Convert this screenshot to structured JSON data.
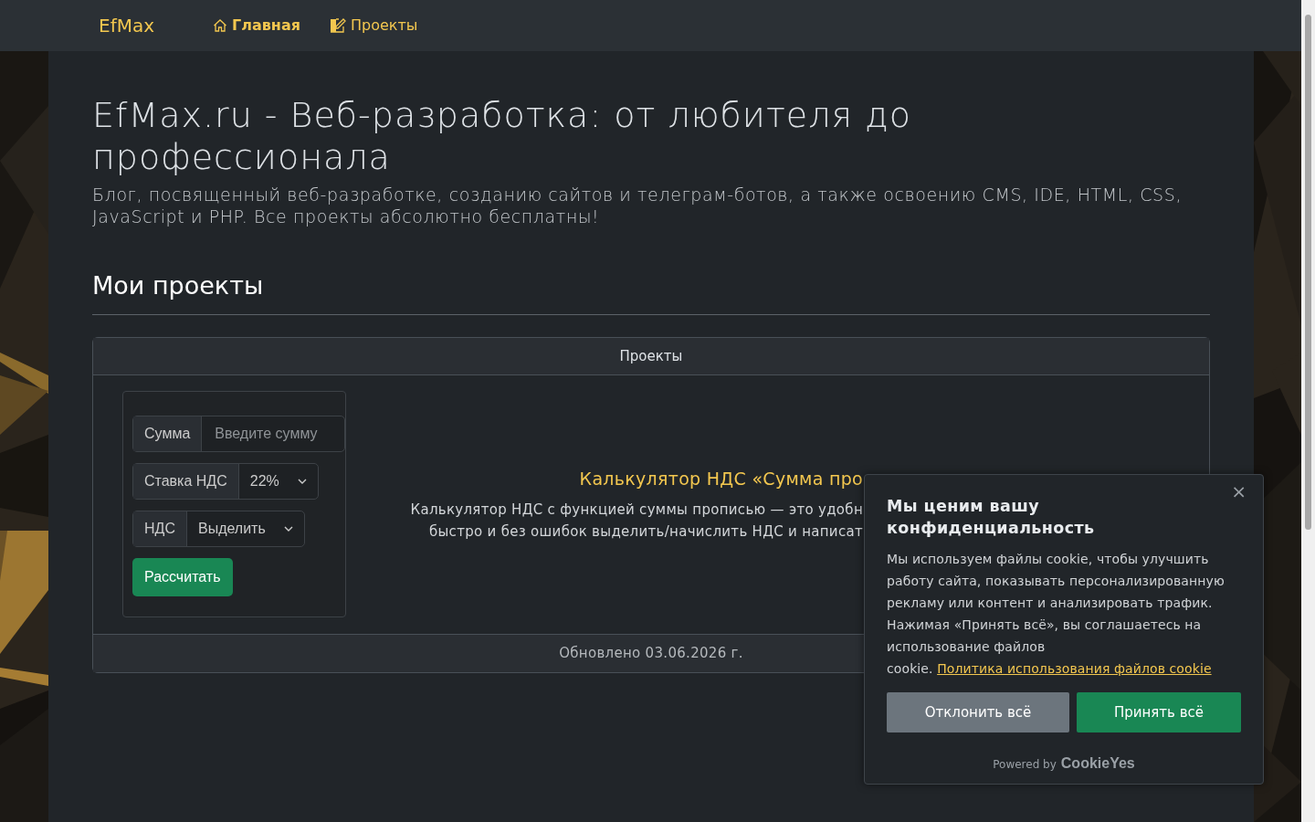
{
  "navbar": {
    "brand": "EfMax",
    "links": [
      {
        "label": "Главная",
        "selected": true
      },
      {
        "label": "Проекты",
        "selected": false
      }
    ]
  },
  "header": {
    "title": "EfMax.ru - Веб-разработка: от любителя до профессионала",
    "subtitle": "Блог, посвященный веб-разработке, созданию сайтов и телеграм-ботов, а также освоению CMS, IDE, HTML, CSS, JavaScript и PHP. Все проекты абсолютно бесплатны!"
  },
  "section_title": "Мои проекты",
  "card": {
    "header": "Проекты",
    "preview": {
      "fields": [
        {
          "kind": "input",
          "label": "Сумма",
          "placeholder": "Введите сумму"
        },
        {
          "kind": "select",
          "label": "Ставка НДС",
          "value": "22%"
        },
        {
          "kind": "select",
          "label": "НДС",
          "value": "Выделить"
        }
      ],
      "button": "Рассчитать"
    },
    "project": {
      "title": "Калькулятор НДС «Сумма про",
      "description_lines": [
        "Калькулятор НДС с функцией суммы прописью — это удобн",
        "быстро и без ошибок выделить/начислить НДС и написат"
      ]
    },
    "footer": "Обновлено 03.06.2026 г."
  },
  "cookie_banner": {
    "close": "×",
    "title": "Мы ценим вашу конфиденциальность",
    "text": "Мы используем файлы cookie, чтобы улучшить работу сайта, показывать персонализированную рекламу или контент и анализировать трафик. Нажимая «Принять всё», вы соглашаетесь на использование файлов cookie.",
    "link": "Политика использования файлов cookie",
    "buttons": [
      {
        "label": "Отклонить всё",
        "kind": "reject"
      },
      {
        "label": "Принять всё",
        "kind": "accept"
      }
    ],
    "powered_by": "Powered by",
    "brand": "CookieYes"
  }
}
